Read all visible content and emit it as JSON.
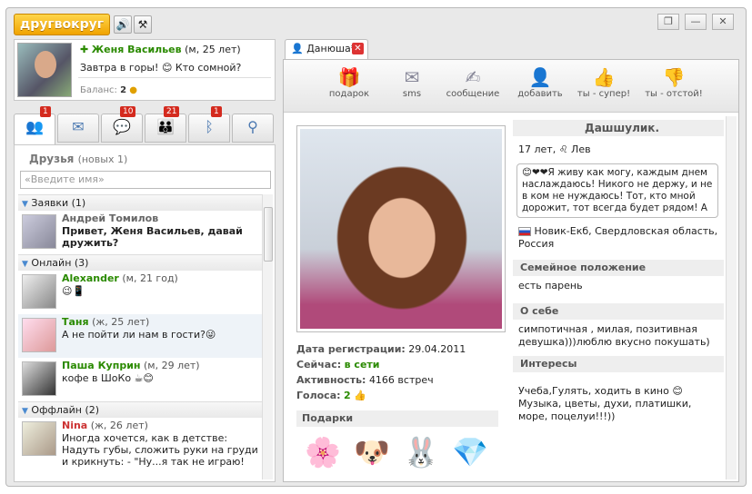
{
  "app": {
    "logo": "другвокруг"
  },
  "toolbar_icons": [
    "sound-icon",
    "settings-icon"
  ],
  "me": {
    "name": "Женя Васильев",
    "meta": "(м, 25 лет)",
    "status": "Завтра в горы! 😊 Кто сомной?",
    "balance_label": "Баланс:",
    "balance_value": "2"
  },
  "left_tabs": [
    {
      "icon": "friends-icon",
      "badge": "1"
    },
    {
      "icon": "mail-icon",
      "badge": ""
    },
    {
      "icon": "chat-icon",
      "badge": "10"
    },
    {
      "icon": "people-icon",
      "badge": "21"
    },
    {
      "icon": "bluetooth-icon",
      "badge": "1"
    },
    {
      "icon": "search-icon",
      "badge": ""
    }
  ],
  "friends": {
    "title": "Друзья",
    "subtitle": "(новых 1)",
    "search_placeholder": "«Введите имя»",
    "requests_group": "Заявки (1)",
    "online_group": "Онлайн (3)",
    "offline_group": "Оффлайн (2)",
    "request": {
      "name": "Андрей Томилов",
      "text": "Привет, Женя Васильев, давай дружить?"
    },
    "online": [
      {
        "name": "Alexander",
        "meta": "(м, 21 год)",
        "text": "😉📱"
      },
      {
        "name": "Таня",
        "meta": "(ж, 25 лет)",
        "text": "А не пойти ли нам в гости?😜"
      },
      {
        "name": "Паша Куприн",
        "meta": "(м, 29 лет)",
        "text": "кофе в ШоКо ☕😊"
      }
    ],
    "offline": [
      {
        "name": "Nina",
        "meta": "(ж, 26 лет)",
        "text": "Иногда хочется, как в детстве: Надуть губы, сложить руки на груди и крикнуть: - \"Ну...я так не играю!"
      }
    ]
  },
  "profile_tab": {
    "label": "Данюша*"
  },
  "actions": [
    {
      "label": "подарок",
      "icon": "gift-icon"
    },
    {
      "label": "sms",
      "icon": "sms-icon"
    },
    {
      "label": "сообщение",
      "icon": "message-icon"
    },
    {
      "label": "добавить",
      "icon": "add-friend-icon"
    },
    {
      "label": "ты - супер!",
      "icon": "thumbs-up-icon"
    },
    {
      "label": "ты - отстой!",
      "icon": "thumbs-down-icon"
    }
  ],
  "profile": {
    "nick": "Дашшулик.",
    "age_sign": "17 лет, ♌ Лев",
    "about_quote": "😊❤❤Я живу как могу, каждым днем наслаждаюсь! Никого не держу, и не в ком не нуждаюсь! Тот, кто мной дорожит, тот всегда будет рядом! А к",
    "location": "Новик-Екб, Свердловская область, Россия",
    "reg_label": "Дата регистрации:",
    "reg_value": "29.04.2011",
    "now_label": "Сейчас:",
    "now_value": "в сети",
    "activity_label": "Активность:",
    "activity_value": "4166 встреч",
    "votes_label": "Голоса:",
    "votes_value": "2",
    "gifts_label": "Подарки",
    "family_label": "Семейное положение",
    "family_value": "есть парень",
    "about_label": "О себе",
    "about_value": "симпотичная , милая, позитивная девушка)))люблю вкусно покушать)",
    "interests_label": "Интересы",
    "interests_value": "Учеба,Гулять, ходить в кино 😊 Музыка, цветы, духи, платишки, море, поцелуи!!!))"
  }
}
